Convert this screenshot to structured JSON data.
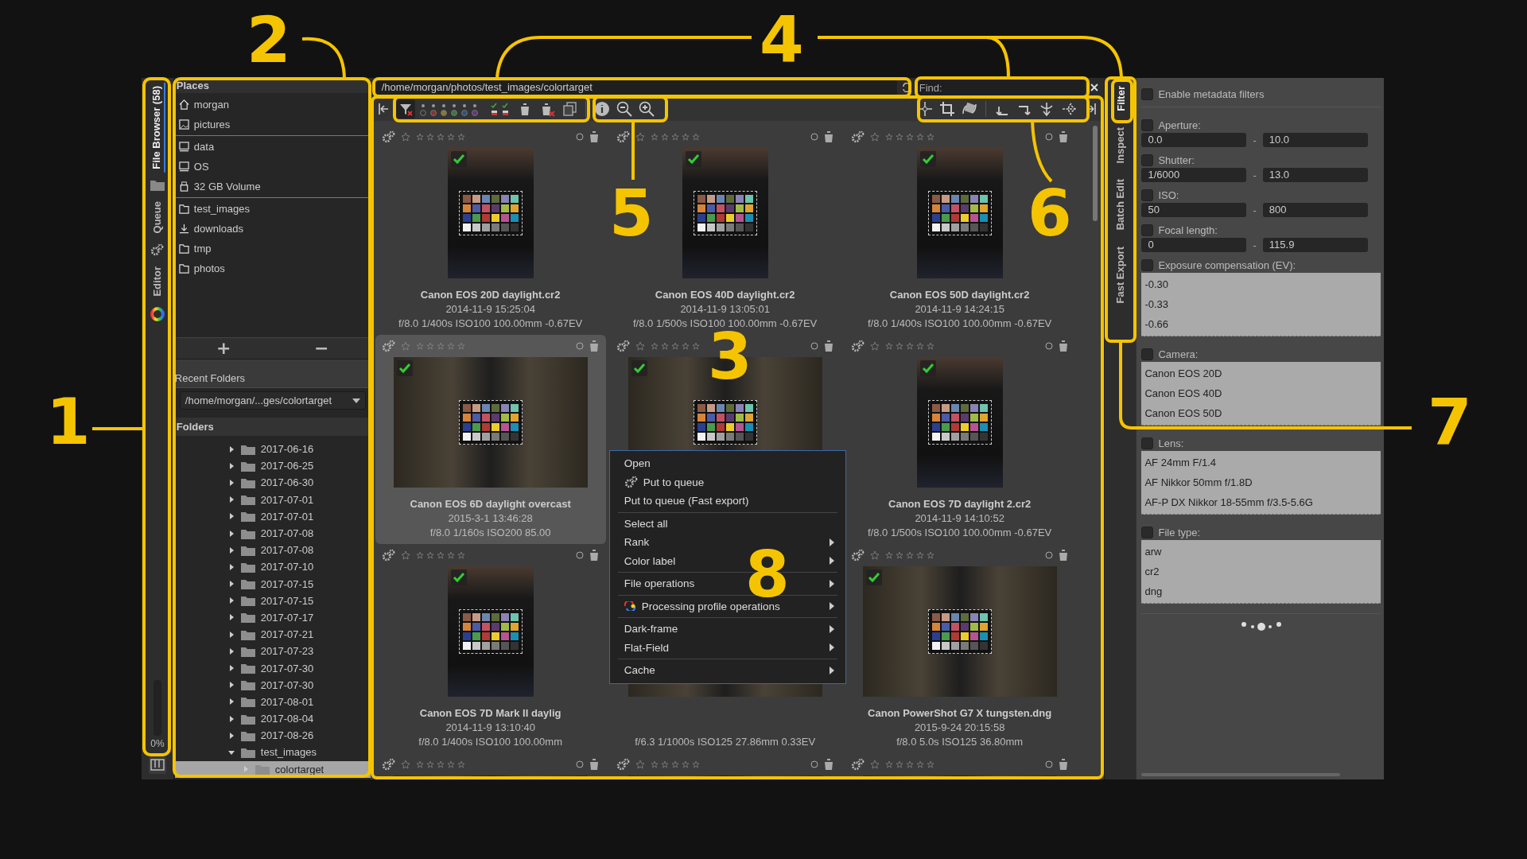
{
  "left_tabs": [
    {
      "label": "File Browser (58)",
      "selected": true
    },
    {
      "label": "Queue",
      "selected": false
    },
    {
      "label": "Editor",
      "selected": false
    }
  ],
  "queue_progress": {
    "level": 0,
    "reading": "0%"
  },
  "places": {
    "title": "Places",
    "groups": [
      {
        "items": [
          {
            "label": "morgan",
            "kind": "home"
          },
          {
            "label": "pictures",
            "kind": "pictures"
          }
        ]
      },
      {
        "items": [
          {
            "label": "data",
            "kind": "drive"
          },
          {
            "label": "OS",
            "kind": "drive"
          },
          {
            "label": "32 GB Volume",
            "kind": "usb"
          }
        ]
      },
      {
        "items": [
          {
            "label": "test_images",
            "kind": "folder"
          },
          {
            "label": "downloads",
            "kind": "download"
          },
          {
            "label": "tmp",
            "kind": "folder"
          },
          {
            "label": "photos",
            "kind": "folder"
          }
        ]
      }
    ],
    "add_button": "+",
    "remove_button": "−"
  },
  "recent_folders": {
    "title": "Recent Folders",
    "value": "/home/morgan/...ges/colortarget"
  },
  "folders": {
    "title": "Folders",
    "items": [
      {
        "label": "2017-06-16",
        "expanded": false,
        "selected": false
      },
      {
        "label": "2017-06-25",
        "expanded": false,
        "selected": false
      },
      {
        "label": "2017-06-30",
        "expanded": false,
        "selected": false
      },
      {
        "label": "2017-07-01",
        "expanded": false,
        "selected": false
      },
      {
        "label": "2017-07-01",
        "expanded": false,
        "selected": false
      },
      {
        "label": "2017-07-08",
        "expanded": false,
        "selected": false
      },
      {
        "label": "2017-07-08",
        "expanded": false,
        "selected": false
      },
      {
        "label": "2017-07-10",
        "expanded": false,
        "selected": false
      },
      {
        "label": "2017-07-15",
        "expanded": false,
        "selected": false
      },
      {
        "label": "2017-07-15",
        "expanded": false,
        "selected": false
      },
      {
        "label": "2017-07-17",
        "expanded": false,
        "selected": false
      },
      {
        "label": "2017-07-21",
        "expanded": false,
        "selected": false
      },
      {
        "label": "2017-07-23",
        "expanded": false,
        "selected": false
      },
      {
        "label": "2017-07-30",
        "expanded": false,
        "selected": false
      },
      {
        "label": "2017-07-30",
        "expanded": false,
        "selected": false
      },
      {
        "label": "2017-08-01",
        "expanded": false,
        "selected": false
      },
      {
        "label": "2017-08-04",
        "expanded": false,
        "selected": false
      },
      {
        "label": "2017-08-26",
        "expanded": false,
        "selected": false
      },
      {
        "label": "test_images",
        "expanded": true,
        "selected": false,
        "children": [
          {
            "label": "colortarget",
            "expanded": false,
            "selected": true
          }
        ]
      }
    ]
  },
  "path_field": {
    "value": "/home/morgan/photos/test_images/colortarget"
  },
  "find_field": {
    "label": "Find:"
  },
  "thumbnails": [
    {
      "title": "Canon EOS 20D daylight.cr2",
      "date": "2014-11-9 15:25:04",
      "exif": "f/8.0 1/400s ISO100 100.00mm -0.67EV",
      "selected": false,
      "stars": 0
    },
    {
      "title": "Canon EOS 40D daylight.cr2",
      "date": "2014-11-9 13:05:01",
      "exif": "f/8.0 1/500s ISO100 100.00mm -0.67EV",
      "selected": false,
      "stars": 0
    },
    {
      "title": "Canon EOS 50D daylight.cr2",
      "date": "2014-11-9 14:24:15",
      "exif": "f/8.0 1/400s ISO100 100.00mm -0.67EV",
      "selected": false,
      "stars": 0
    },
    {
      "title": "Canon EOS 6D daylight overcast",
      "date": "2015-3-1 13:46:28",
      "exif": "f/8.0 1/160s ISO200 85.00",
      "selected": true,
      "stars": 0
    },
    {
      "selected": false,
      "stars": 0
    },
    {
      "title": "Canon EOS 7D daylight 2.cr2",
      "date": "2014-11-9 14:10:52",
      "exif": "f/8.0 1/500s ISO100 100.00mm -0.67EV",
      "selected": false,
      "stars": 0
    },
    {
      "title": "Canon EOS 7D Mark II daylig",
      "date": "2014-11-9 13:10:40",
      "exif": "f/8.0 1/400s ISO100 100.00mm",
      "selected": false,
      "stars": 0
    },
    {
      "exif": "f/6.3 1/1000s ISO125 27.86mm 0.33EV",
      "selected": false
    },
    {
      "title": "Canon PowerShot G7 X tungsten.dng",
      "date": "2015-9-24 20:15:58",
      "exif": "f/8.0 5.0s ISO125 36.80mm",
      "selected": false,
      "stars": 0
    },
    {
      "selected": false,
      "stars": 0
    },
    {
      "selected": false,
      "stars": 0
    },
    {
      "selected": false,
      "stars": 0
    }
  ],
  "context_menu": [
    {
      "kind": "item",
      "label": "Open",
      "submenu": false
    },
    {
      "kind": "item",
      "label": "Put to queue",
      "submenu": false
    },
    {
      "kind": "item",
      "label": "Put to queue (Fast export)",
      "submenu": false
    },
    {
      "kind": "separator"
    },
    {
      "kind": "item",
      "label": "Select all",
      "submenu": false
    },
    {
      "kind": "item",
      "label": "Rank",
      "submenu": true
    },
    {
      "kind": "item",
      "label": "Color label",
      "submenu": true
    },
    {
      "kind": "separator"
    },
    {
      "kind": "item",
      "label": "File operations",
      "submenu": true
    },
    {
      "kind": "separator"
    },
    {
      "kind": "item",
      "label": "Processing profile operations",
      "submenu": true
    },
    {
      "kind": "separator"
    },
    {
      "kind": "item",
      "label": "Dark-frame",
      "submenu": true
    },
    {
      "kind": "item",
      "label": "Flat-Field",
      "submenu": true
    },
    {
      "kind": "separator"
    },
    {
      "kind": "item",
      "label": "Cache",
      "submenu": true
    }
  ],
  "right_tabs": [
    {
      "label": "Filter",
      "selected": true
    },
    {
      "label": "Inspect",
      "selected": false
    },
    {
      "label": "Batch Edit",
      "selected": false
    },
    {
      "label": "Fast Export",
      "selected": false
    }
  ],
  "filter_panel": {
    "enable": {
      "label": "Enable metadata filters",
      "checked": false
    },
    "ranges": [
      {
        "label": "Aperture:",
        "checked": false,
        "from": "0.0",
        "to": "10.0"
      },
      {
        "label": "Shutter:",
        "checked": false,
        "from": "1/6000",
        "to": "13.0"
      },
      {
        "label": "ISO:",
        "checked": false,
        "from": "50",
        "to": "800"
      },
      {
        "label": "Focal length:",
        "checked": false,
        "from": "0",
        "to": "115.9"
      }
    ],
    "range_separator": "-",
    "lists": [
      {
        "label": "Exposure compensation (EV):",
        "checked": false,
        "items": [
          "-0.30",
          "-0.33",
          "-0.66"
        ]
      },
      {
        "label": "Camera:",
        "checked": false,
        "items": [
          "Canon EOS 20D",
          "Canon EOS 40D",
          "Canon EOS 50D"
        ]
      },
      {
        "label": "Lens:",
        "checked": false,
        "items": [
          "AF 24mm F/1.4",
          "AF Nikkor 50mm f/1.8D",
          "AF-P DX Nikkor 18-55mm f/3.5-5.6G"
        ]
      },
      {
        "label": "File type:",
        "checked": false,
        "items": [
          "arw",
          "cr2",
          "dng"
        ]
      }
    ]
  },
  "callouts": [
    "1",
    "2",
    "3",
    "4",
    "5",
    "6",
    "7",
    "8"
  ]
}
